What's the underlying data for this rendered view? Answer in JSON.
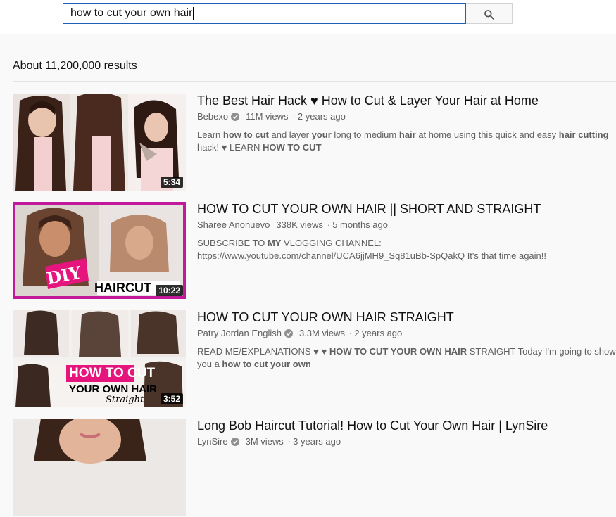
{
  "search": {
    "query": "how to cut your own hair",
    "button_icon": "search-icon"
  },
  "results_count": "About 11,200,000 results",
  "results": [
    {
      "title": "The Best Hair Hack ♥ How to Cut & Layer Your Hair at Home",
      "channel": "Bebexo",
      "verified": true,
      "views": "11M views",
      "age": "2 years ago",
      "duration": "5:34",
      "desc": [
        {
          "t": "Learn ",
          "b": false
        },
        {
          "t": "how to cut",
          "b": true
        },
        {
          "t": " and layer ",
          "b": false
        },
        {
          "t": "your",
          "b": true
        },
        {
          "t": " long to medium ",
          "b": false
        },
        {
          "t": "hair",
          "b": true
        },
        {
          "t": " at home using this quick and easy ",
          "b": false
        },
        {
          "t": "hair cutting",
          "b": true
        },
        {
          "t": " hack! ♥ LEARN ",
          "b": false
        },
        {
          "t": "HOW TO CUT",
          "b": true
        }
      ]
    },
    {
      "title": "HOW TO CUT YOUR OWN HAIR || SHORT AND STRAIGHT",
      "channel": "Sharee Anonuevo",
      "verified": false,
      "views": "338K views",
      "age": "5 months ago",
      "duration": "10:22",
      "thumb_text": [
        "DIY",
        "HAIRCUT"
      ],
      "desc": [
        {
          "t": "SUBSCRIBE TO ",
          "b": false
        },
        {
          "t": "MY",
          "b": true
        },
        {
          "t": " VLOGGING CHANNEL: https://www.youtube.com/channel/UCA6jjMH9_Sq81uBb-SpQakQ It's that time again!!",
          "b": false
        }
      ]
    },
    {
      "title": "HOW TO CUT YOUR OWN HAIR STRAIGHT",
      "channel": "Patry Jordan English",
      "verified": true,
      "views": "3.3M views",
      "age": "2 years ago",
      "duration": "3:52",
      "thumb_text": [
        "HOW TO CUT",
        "YOUR OWN HAIR",
        "Straight"
      ],
      "desc": [
        {
          "t": "READ ME/EXPLANATIONS ♥ ♥ ",
          "b": false
        },
        {
          "t": "HOW TO CUT YOUR OWN HAIR",
          "b": true
        },
        {
          "t": " STRAIGHT Today I'm going to show you a ",
          "b": false
        },
        {
          "t": "how to cut your own",
          "b": true
        }
      ]
    },
    {
      "title": "Long Bob Haircut Tutorial! How to Cut Your Own Hair | LynSire",
      "channel": "LynSire",
      "verified": true,
      "views": "3M views",
      "age": "3 years ago",
      "duration": "",
      "desc": []
    }
  ],
  "colors": {
    "accent_border": "#1c62b9",
    "thumb2_border": "#c2199a",
    "pink_label": "#e5157d"
  }
}
